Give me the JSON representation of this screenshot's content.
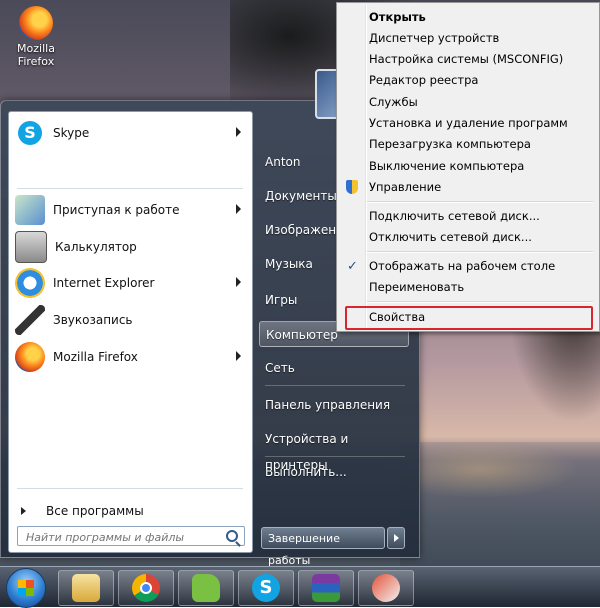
{
  "desktop": {
    "icon_label_line1": "Mozilla",
    "icon_label_line2": "Firefox"
  },
  "start_menu": {
    "pinned": [
      {
        "label": "Skype",
        "icon": "skype-icon",
        "has_submenu": true
      }
    ],
    "recent": [
      {
        "label": "Приступая к работе",
        "icon": "getting-started-icon",
        "has_submenu": true
      },
      {
        "label": "Калькулятор",
        "icon": "calculator-icon",
        "has_submenu": false
      },
      {
        "label": "Internet Explorer",
        "icon": "internet-explorer-icon",
        "has_submenu": true
      },
      {
        "label": "Звукозапись",
        "icon": "microphone-icon",
        "has_submenu": false
      },
      {
        "label": "Mozilla Firefox",
        "icon": "firefox-icon",
        "has_submenu": true
      }
    ],
    "all_programs": "Все программы",
    "search_placeholder": "Найти программы и файлы",
    "right_items": [
      {
        "label": "Anton"
      },
      {
        "label": "Документы"
      },
      {
        "label": "Изображения"
      },
      {
        "label": "Музыка"
      },
      {
        "label": "Игры"
      },
      {
        "label": "Компьютер",
        "active": true
      },
      {
        "label": "Сеть"
      },
      {
        "label": "Панель управления"
      },
      {
        "label": "Устройства и принтеры"
      },
      {
        "label": "Выполнить..."
      }
    ],
    "shutdown_label": "Завершение работы"
  },
  "context_menu": {
    "items": [
      {
        "label": "Открыть",
        "bold": true
      },
      {
        "label": "Диспетчер устройств"
      },
      {
        "label": "Настройка системы (MSCONFIG)"
      },
      {
        "label": "Редактор реестра"
      },
      {
        "label": "Службы"
      },
      {
        "label": "Установка и удаление программ"
      },
      {
        "label": "Перезагрузка компьютера"
      },
      {
        "label": "Выключение компьютера"
      },
      {
        "label": "Управление",
        "icon": "uac-shield-icon"
      },
      {
        "label": "Подключить сетевой диск..."
      },
      {
        "label": "Отключить сетевой диск..."
      },
      {
        "label": "Отображать на рабочем столе",
        "checked": true
      },
      {
        "label": "Переименовать"
      },
      {
        "label": "Свойства",
        "highlighted": true
      }
    ],
    "highlight_color": "#d9262e"
  },
  "taskbar": {
    "buttons": [
      "windows-explorer-icon",
      "chrome-icon",
      "evernote-icon",
      "skype-icon",
      "winrar-icon",
      "ccleaner-icon"
    ]
  }
}
